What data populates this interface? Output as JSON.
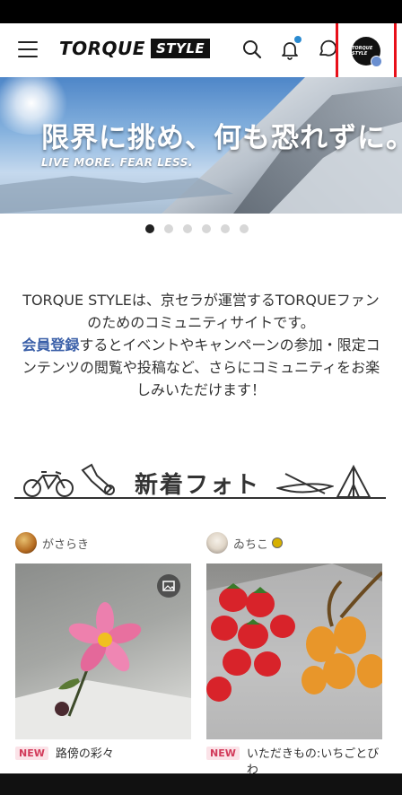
{
  "header": {
    "logo_word": "TORQUE",
    "logo_box": "STYLE",
    "avatar_text": "TORQUE STYLE"
  },
  "hero": {
    "title": "限界に挑め、何も恐れずに。",
    "subtitle": "LIVE MORE. FEAR LESS.",
    "slide_count": 6,
    "active_slide": 1
  },
  "intro": {
    "part1": "TORQUE STYLEは、京セラが運営するTORQUEファンのためのコミュニティサイトです。",
    "link": "会員登録",
    "part2": "するとイベントやキャンペーンの参加・限定コンテンツの閲覧や投稿など、さらにコミュニティをお楽しみいただけます！"
  },
  "section": {
    "title": "新着フォト"
  },
  "posts": [
    {
      "username": "がさらき",
      "badge": "NEW",
      "caption": "路傍の彩々"
    },
    {
      "username": "ゐちこ",
      "badge": "NEW",
      "caption": "いただきもの:いちごとびわ"
    }
  ],
  "colors": {
    "accent_link": "#3a5fa8",
    "highlight_box": "#e8101a",
    "notify_dot": "#2a8ad0",
    "new_badge": "#d23a5a"
  }
}
